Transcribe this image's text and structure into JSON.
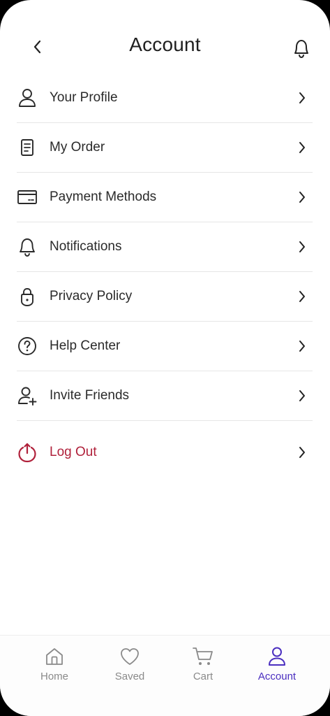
{
  "header": {
    "title": "Account"
  },
  "menu": {
    "items": [
      {
        "label": "Your Profile",
        "icon": "user-icon"
      },
      {
        "label": "My Order",
        "icon": "document-icon"
      },
      {
        "label": "Payment Methods",
        "icon": "card-icon"
      },
      {
        "label": "Notifications",
        "icon": "bell-icon"
      },
      {
        "label": "Privacy Policy",
        "icon": "lock-icon"
      },
      {
        "label": "Help Center",
        "icon": "help-icon"
      },
      {
        "label": "Invite Friends",
        "icon": "user-plus-icon"
      }
    ],
    "logout": {
      "label": "Log Out",
      "icon": "power-icon",
      "color": "#b0213b"
    }
  },
  "tabs": [
    {
      "label": "Home",
      "icon": "home-icon",
      "active": false
    },
    {
      "label": "Saved",
      "icon": "heart-icon",
      "active": false
    },
    {
      "label": "Cart",
      "icon": "cart-icon",
      "active": false
    },
    {
      "label": "Account",
      "icon": "user-icon",
      "active": true
    }
  ],
  "colors": {
    "accent": "#4b2fc0",
    "danger": "#b0213b",
    "text": "#2a2a2a",
    "muted": "#8a8a8a"
  }
}
